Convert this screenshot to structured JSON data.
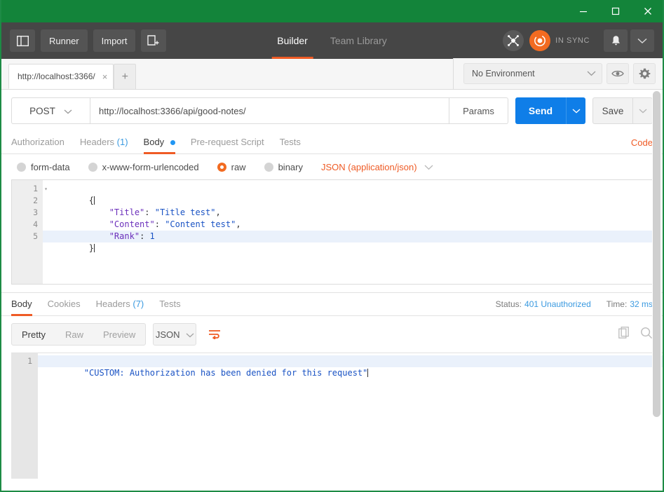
{
  "window": {
    "minimize_label": "minimize",
    "maximize_label": "maximize",
    "close_label": "close",
    "titlebar_color": "#13843a"
  },
  "toolbar": {
    "sidebar_toggle": "sidebar-toggle",
    "runner_label": "Runner",
    "import_label": "Import",
    "new_window_label": "new-window",
    "tabs": [
      {
        "label": "Builder",
        "active": true
      },
      {
        "label": "Team Library",
        "active": false
      }
    ],
    "interceptor_label": "interceptor",
    "sync_label": "IN SYNC",
    "sync_color": "#f26b21",
    "notifications_label": "notifications",
    "user_menu_label": "user-menu"
  },
  "tabstrip": {
    "tabs": [
      {
        "title": "http://localhost:3366/",
        "close": "×",
        "active": true
      }
    ],
    "new_tab": "+",
    "environment": {
      "selected": "No Environment",
      "chevron": "∨",
      "eye_label": "environment-quick-look",
      "gear_label": "manage-environments"
    }
  },
  "request": {
    "method": "POST",
    "method_chevron": "∨",
    "url": "http://localhost:3366/api/good-notes/",
    "params_label": "Params",
    "send_label": "Send",
    "send_chevron": "∨",
    "send_color": "#0f7ee8",
    "save_label": "Save",
    "save_chevron": "∨",
    "tabs": [
      {
        "label": "Authorization",
        "count": "",
        "dot": false,
        "active": false
      },
      {
        "label": "Headers",
        "count": "(1)",
        "dot": false,
        "active": false
      },
      {
        "label": "Body",
        "count": "",
        "dot": true,
        "active": true
      },
      {
        "label": "Pre-request Script",
        "count": "",
        "dot": false,
        "active": false
      },
      {
        "label": "Tests",
        "count": "",
        "dot": false,
        "active": false
      }
    ],
    "code_link": "Code",
    "body_types": [
      {
        "label": "form-data",
        "checked": false
      },
      {
        "label": "x-www-form-urlencoded",
        "checked": false
      },
      {
        "label": "raw",
        "checked": true
      },
      {
        "label": "binary",
        "checked": false
      }
    ],
    "content_type": "JSON (application/json)",
    "content_type_chevron": "∨",
    "body_lines": [
      {
        "num": "1",
        "fold": "▾",
        "segments": [
          {
            "text": "{",
            "type": "punc"
          }
        ],
        "highlighted": false
      },
      {
        "num": "2",
        "fold": "",
        "segments": [
          {
            "text": "    ",
            "type": "punc"
          },
          {
            "text": "\"Title\"",
            "type": "key"
          },
          {
            "text": ": ",
            "type": "punc"
          },
          {
            "text": "\"Title test\"",
            "type": "str"
          },
          {
            "text": ",",
            "type": "punc"
          }
        ],
        "highlighted": false
      },
      {
        "num": "3",
        "fold": "",
        "segments": [
          {
            "text": "    ",
            "type": "punc"
          },
          {
            "text": "\"Content\"",
            "type": "key"
          },
          {
            "text": ": ",
            "type": "punc"
          },
          {
            "text": "\"Content test\"",
            "type": "str"
          },
          {
            "text": ",",
            "type": "punc"
          }
        ],
        "highlighted": false
      },
      {
        "num": "4",
        "fold": "",
        "segments": [
          {
            "text": "    ",
            "type": "punc"
          },
          {
            "text": "\"Rank\"",
            "type": "key"
          },
          {
            "text": ": ",
            "type": "punc"
          },
          {
            "text": "1",
            "type": "num"
          }
        ],
        "highlighted": false
      },
      {
        "num": "5",
        "fold": "",
        "segments": [
          {
            "text": "}",
            "type": "punc"
          }
        ],
        "highlighted": true
      }
    ]
  },
  "response": {
    "tabs": [
      {
        "label": "Body",
        "count": "",
        "active": true
      },
      {
        "label": "Cookies",
        "count": "",
        "active": false
      },
      {
        "label": "Headers",
        "count": "(7)",
        "active": false
      },
      {
        "label": "Tests",
        "count": "",
        "active": false
      }
    ],
    "status_label": "Status:",
    "status_value": "401 Unauthorized",
    "time_label": "Time:",
    "time_value": "32 ms",
    "view_modes": [
      {
        "label": "Pretty",
        "active": true
      },
      {
        "label": "Raw",
        "active": false
      },
      {
        "label": "Preview",
        "active": false
      }
    ],
    "format": "JSON",
    "format_chevron": "∨",
    "wrap_label": "word-wrap-toggle",
    "wrap_color": "#ef5b25",
    "copy_label": "copy-to-clipboard",
    "search_label": "search-response",
    "body_lines": [
      {
        "num": "1",
        "segments": [
          {
            "text": "\"CUSTOM: Authorization has been denied for this request\"",
            "type": "str"
          }
        ],
        "highlighted": true
      }
    ]
  }
}
